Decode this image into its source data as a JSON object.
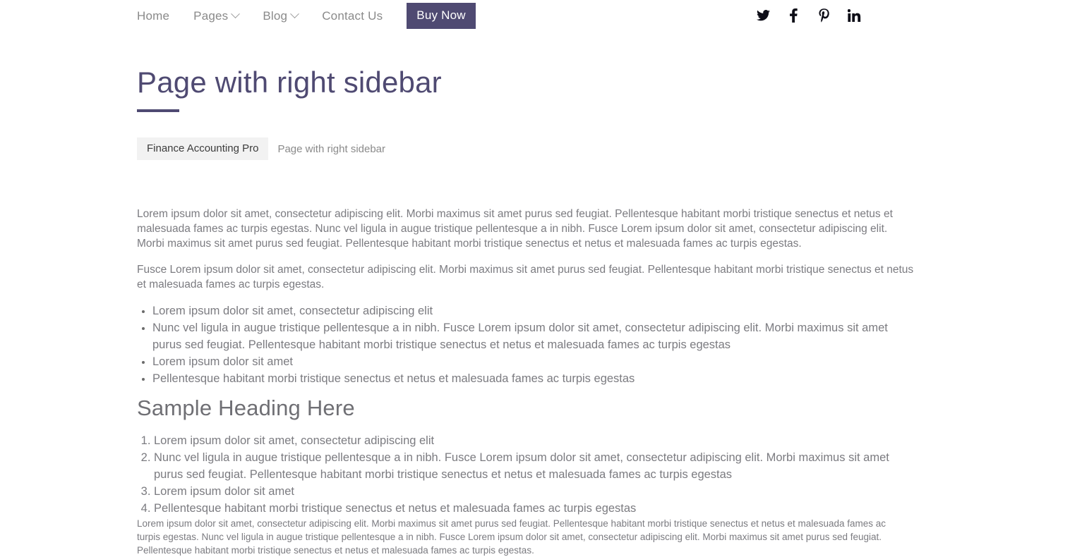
{
  "header": {
    "nav": [
      {
        "label": "Home",
        "has_dropdown": false,
        "highlight": false
      },
      {
        "label": "Pages",
        "has_dropdown": true,
        "highlight": false
      },
      {
        "label": "Blog",
        "has_dropdown": true,
        "highlight": false
      },
      {
        "label": "Contact Us",
        "has_dropdown": false,
        "highlight": false
      },
      {
        "label": "Buy Now",
        "has_dropdown": false,
        "highlight": true
      }
    ],
    "social": [
      {
        "name": "twitter-icon"
      },
      {
        "name": "facebook-icon"
      },
      {
        "name": "pinterest-icon"
      },
      {
        "name": "linkedin-icon"
      }
    ]
  },
  "page": {
    "title": "Page with right sidebar",
    "breadcrumb": {
      "home": "Finance Accounting Pro",
      "current": "Page with right sidebar"
    },
    "paragraph_1": "Lorem ipsum dolor sit amet, consectetur adipiscing elit. Morbi maximus sit amet purus sed feugiat. Pellentesque habitant morbi tristique senectus et netus et malesuada fames ac turpis egestas. Nunc vel ligula in augue tristique pellentesque a in nibh. Fusce Lorem ipsum dolor sit amet, consectetur adipiscing elit. Morbi maximus sit amet purus sed feugiat. Pellentesque habitant morbi tristique senectus et netus et malesuada fames ac turpis egestas.",
    "paragraph_2": "Fusce Lorem ipsum dolor sit amet, consectetur adipiscing elit. Morbi maximus sit amet purus sed feugiat. Pellentesque habitant morbi tristique senectus et netus et malesuada fames ac turpis egestas.",
    "bullet_list": [
      "Lorem ipsum dolor sit amet, consectetur adipiscing elit",
      "Nunc vel ligula in augue tristique pellentesque a in nibh. Fusce Lorem ipsum dolor sit amet, consectetur adipiscing elit. Morbi maximus sit amet purus sed feugiat. Pellentesque habitant morbi tristique senectus et netus et malesuada fames ac turpis egestas",
      "Lorem ipsum dolor sit amet",
      "Pellentesque habitant morbi tristique senectus et netus et malesuada fames ac turpis egestas"
    ],
    "sample_heading": "Sample Heading Here",
    "numbered_list": [
      "Lorem ipsum dolor sit amet, consectetur adipiscing elit",
      "Nunc vel ligula in augue tristique pellentesque a in nibh. Fusce Lorem ipsum dolor sit amet, consectetur adipiscing elit. Morbi maximus sit amet purus sed feugiat. Pellentesque habitant morbi tristique senectus et netus et malesuada fames ac turpis egestas",
      "Lorem ipsum dolor sit amet",
      "Pellentesque habitant morbi tristique senectus et netus et malesuada fames ac turpis egestas"
    ],
    "paragraph_3": "Lorem ipsum dolor sit amet, consectetur adipiscing elit. Morbi maximus sit amet purus sed feugiat. Pellentesque habitant morbi tristique senectus et netus et malesuada fames ac turpis egestas. Nunc vel ligula in augue tristique pellentesque a in nibh. Fusce Lorem ipsum dolor sit amet, consectetur adipiscing elit. Morbi maximus sit amet purus sed feugiat. Pellentesque habitant morbi tristique senectus et netus et malesuada fames ac turpis egestas."
  },
  "colors": {
    "accent": "#4f4a72",
    "body_text": "#7b7b80",
    "nav_text": "#8a8a8a",
    "crumb_bg": "#f2f2f2"
  }
}
